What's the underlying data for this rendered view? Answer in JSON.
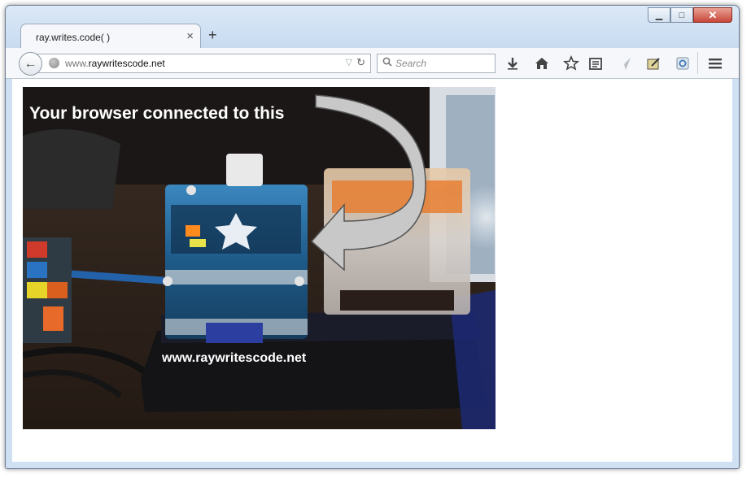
{
  "tab": {
    "title": "ray.writes.code( )",
    "close_glyph": "×",
    "new_tab_glyph": "+"
  },
  "window_controls": {
    "minimize": "▁",
    "maximize": "□",
    "close": "✕"
  },
  "toolbar": {
    "back_glyph": "←",
    "url_prefix": "www.",
    "url_domain": "raywritescode.net",
    "dropdown_glyph": "▽",
    "reload_glyph": "↻",
    "search_placeholder": "Search",
    "icons": [
      "download-icon",
      "home-icon",
      "bookmark-star-icon",
      "reading-list-icon",
      "send-icon",
      "notes-icon",
      "extension-icon",
      "menu-icon"
    ]
  },
  "page": {
    "caption": "Your browser connected to this",
    "site_url": "www.raywritescode.net"
  },
  "colors": {
    "arrow_fill": "#c8c8c8",
    "photo_dark": "#211c19",
    "case_blue": "#1d4f78"
  }
}
